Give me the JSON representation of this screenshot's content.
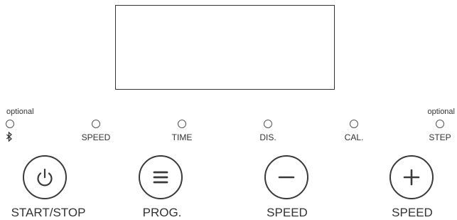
{
  "display": {
    "content": ""
  },
  "optional_labels": {
    "left": "optional",
    "right": "optional"
  },
  "indicators": [
    {
      "label": "",
      "icon": "bluetooth-icon"
    },
    {
      "label": "SPEED"
    },
    {
      "label": "TIME"
    },
    {
      "label": "DIS."
    },
    {
      "label": "CAL."
    },
    {
      "label": "STEP"
    }
  ],
  "buttons": [
    {
      "label": "START/STOP",
      "icon": "power-icon"
    },
    {
      "label": "PROG.",
      "icon": "menu-icon"
    },
    {
      "label": "SPEED",
      "icon": "minus-icon"
    },
    {
      "label": "SPEED",
      "icon": "plus-icon"
    }
  ],
  "colors": {
    "line": "#333333",
    "button_border": "#3a3a3a",
    "background": "#ffffff"
  }
}
